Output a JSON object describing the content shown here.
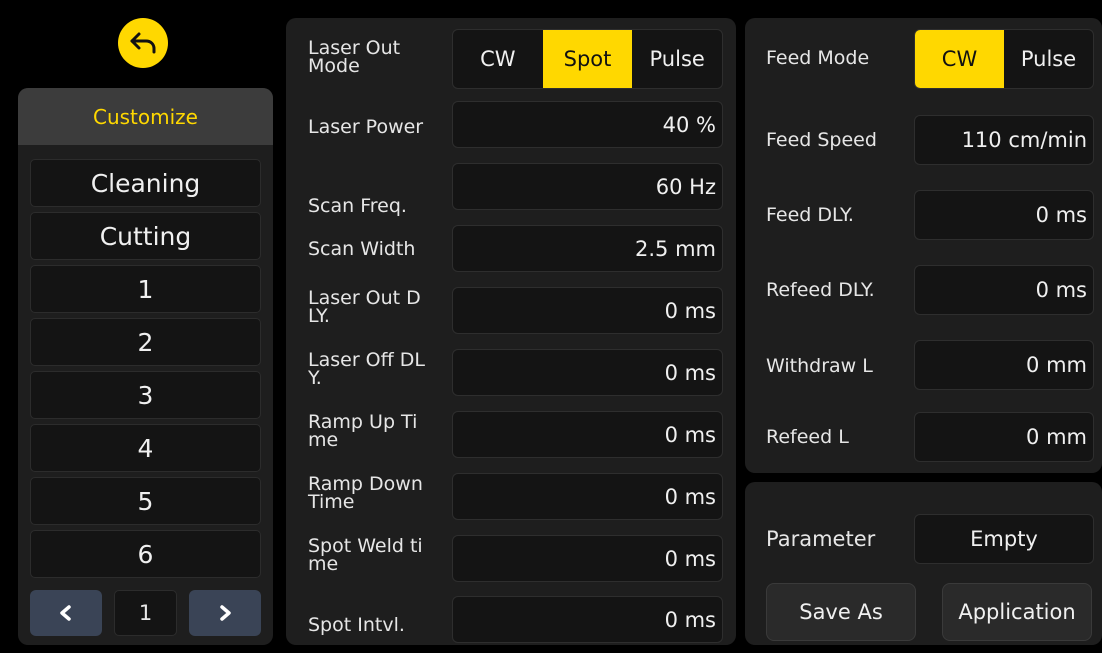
{
  "colors": {
    "accent": "#ffd800",
    "panel": "#1e1e1e",
    "field": "#141414",
    "background": "#000000"
  },
  "sidebar": {
    "back_icon": "undo-arrow-icon",
    "header": "Customize",
    "presets": [
      "Cleaning",
      "Cutting",
      "1",
      "2",
      "3",
      "4",
      "5",
      "6"
    ],
    "pager": {
      "prev_icon": "chevron-left-icon",
      "page": "1",
      "next_icon": "chevron-right-icon"
    }
  },
  "laser": {
    "out_mode": {
      "label": "Laser Out\nMode",
      "options": [
        "CW",
        "Spot",
        "Pulse"
      ],
      "selected": "Spot"
    },
    "params": [
      {
        "label": "Laser Power",
        "value": "40 %"
      },
      {
        "label": "Scan Freq.",
        "value": "60 Hz"
      },
      {
        "label": "Scan Width",
        "value": "2.5 mm"
      },
      {
        "label": "Laser Out D\nLY.",
        "value": "0 ms"
      },
      {
        "label": "Laser Off DL\nY.",
        "value": "0 ms"
      },
      {
        "label": "Ramp Up Ti\nme",
        "value": "0 ms"
      },
      {
        "label": "Ramp Down\n Time",
        "value": "0 ms"
      },
      {
        "label": "Spot Weld ti\nme",
        "value": "0 ms"
      },
      {
        "label": "Spot Intvl.",
        "value": "0 ms"
      }
    ]
  },
  "feed": {
    "mode": {
      "label": "Feed Mode",
      "options": [
        "CW",
        "Pulse"
      ],
      "selected": "CW"
    },
    "params": [
      {
        "label": "Feed Speed",
        "value": "110 cm/min"
      },
      {
        "label": "Feed DLY.",
        "value": "0 ms"
      },
      {
        "label": "Refeed DLY.",
        "value": "0 ms"
      },
      {
        "label": "Withdraw L",
        "value": "0 mm"
      },
      {
        "label": "Refeed L",
        "value": "0 mm"
      }
    ]
  },
  "parameter": {
    "label": "Parameter",
    "value": "Empty",
    "save_label": "Save As",
    "apply_label": "Application"
  }
}
